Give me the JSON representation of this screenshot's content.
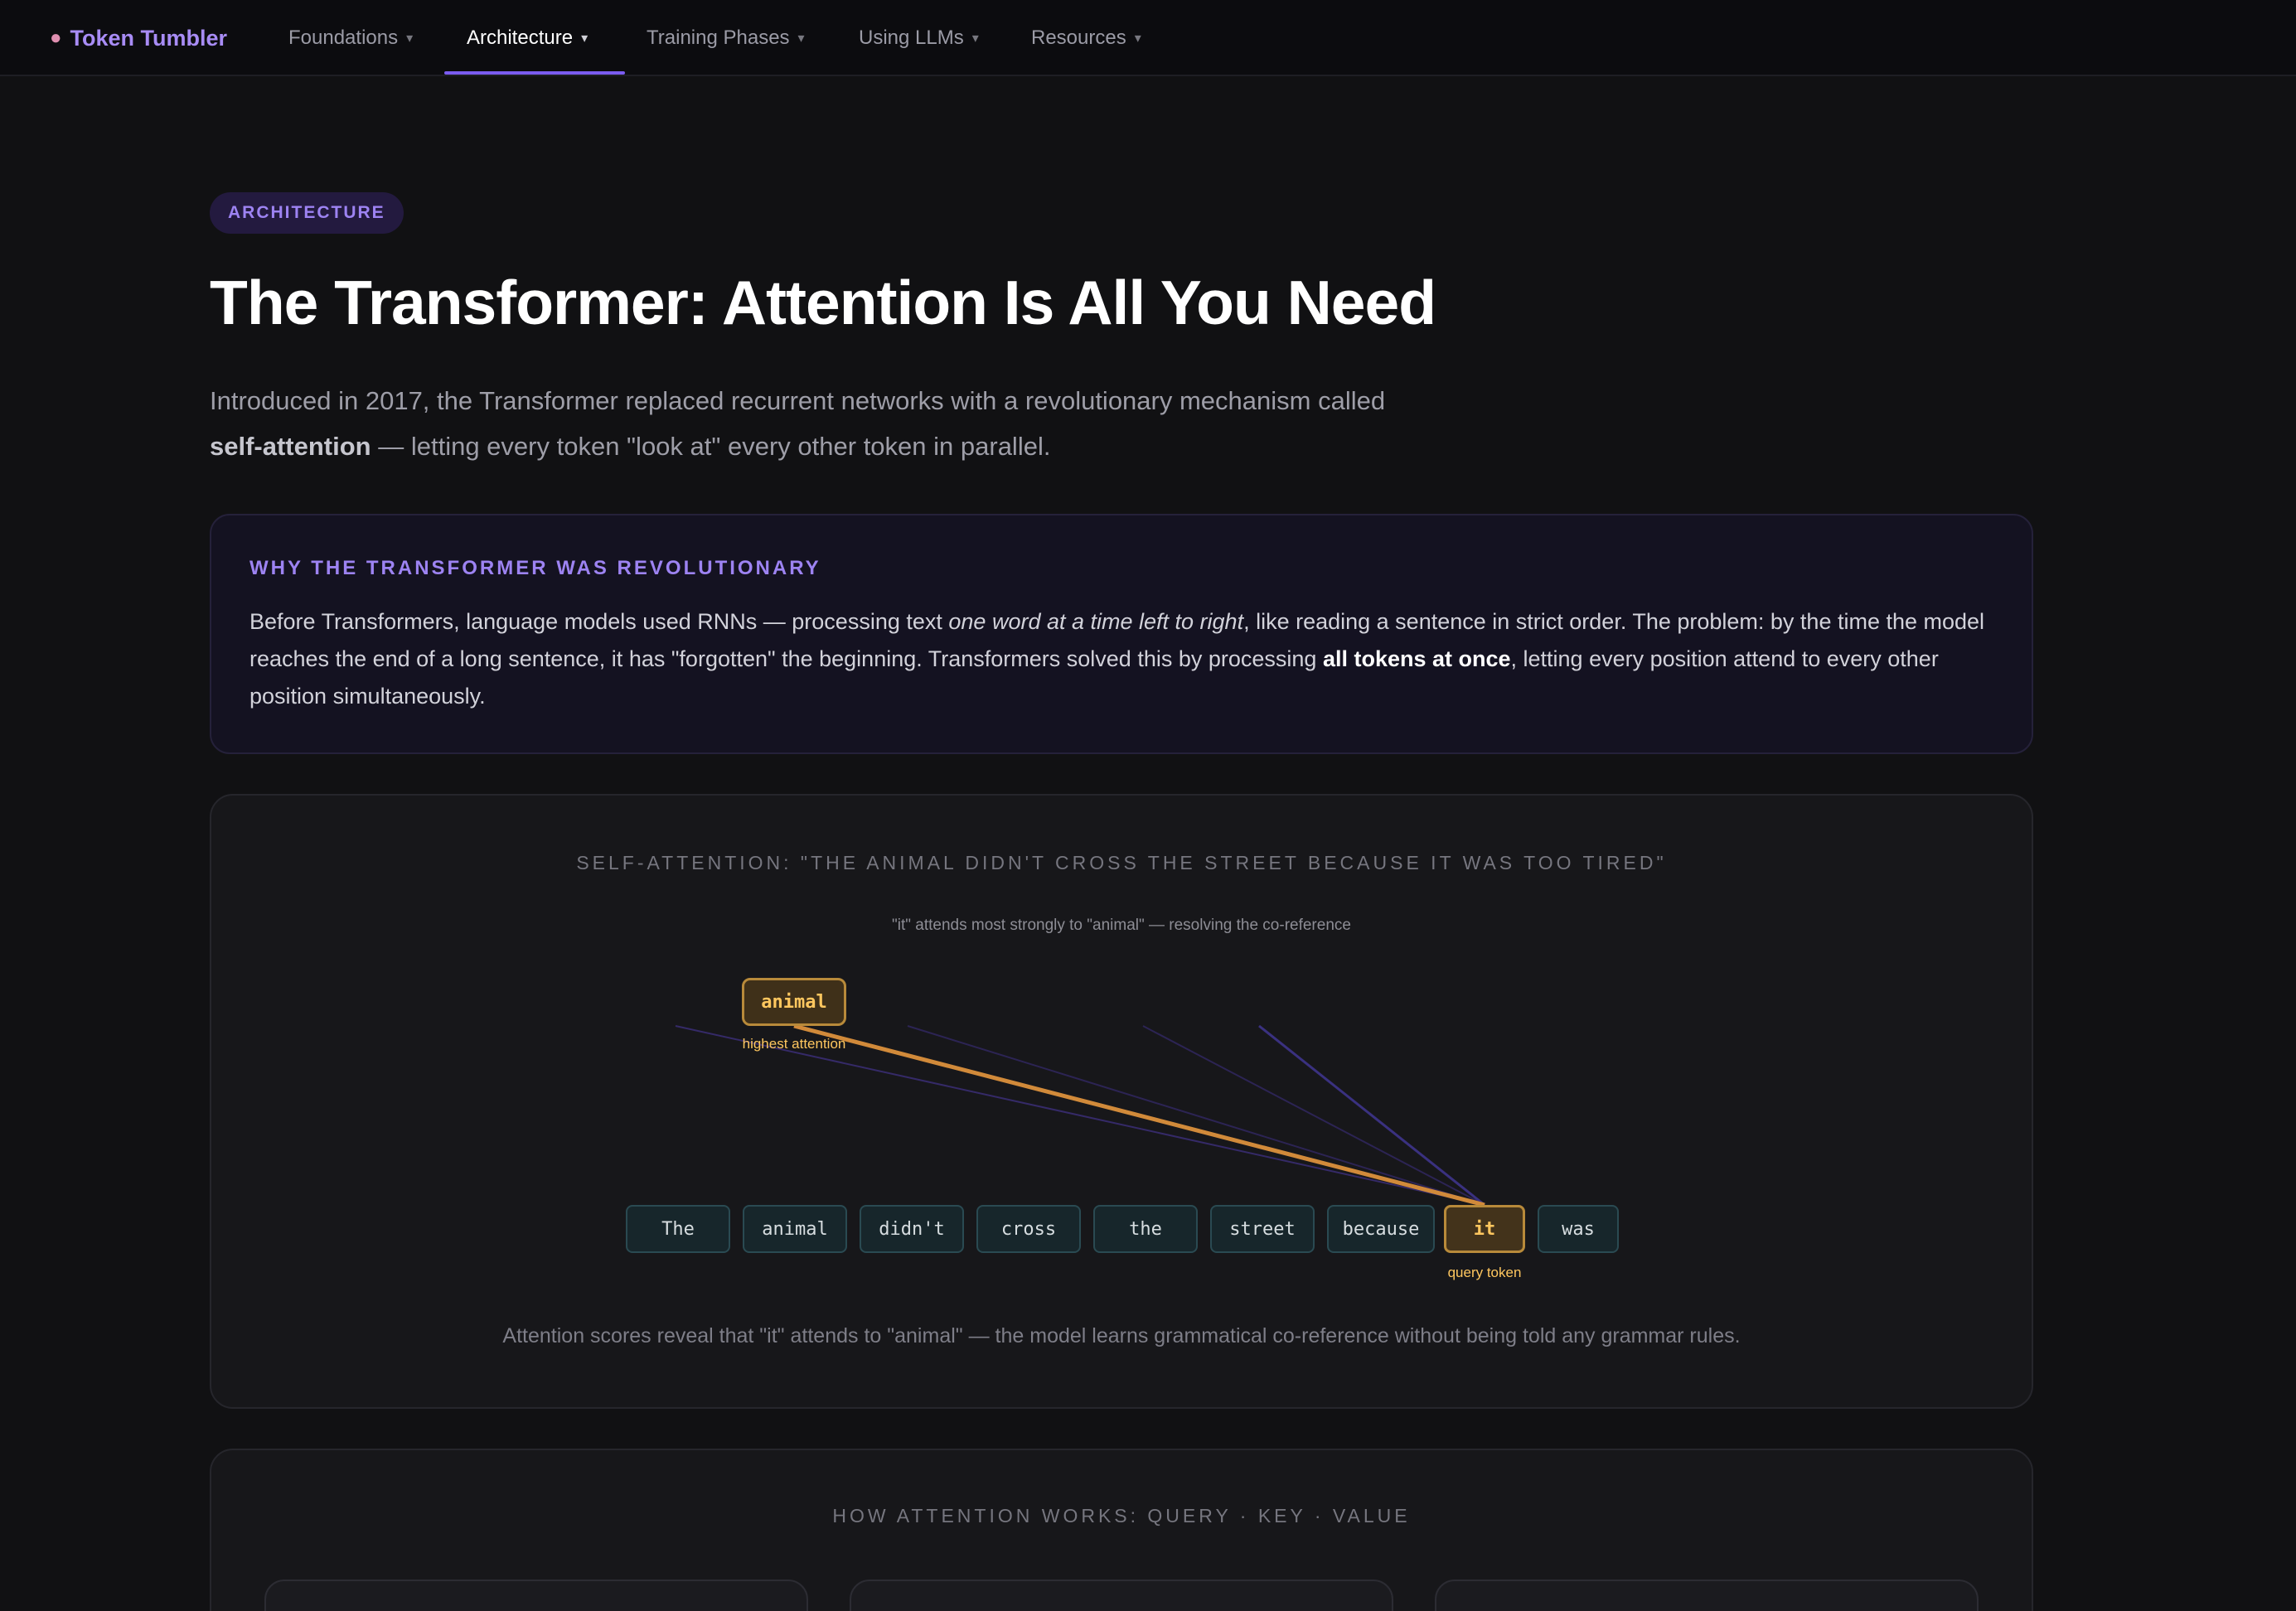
{
  "nav": {
    "brand": "Token Tumbler",
    "brand_icon": "brain-icon",
    "items": [
      {
        "label": "Foundations",
        "active": false
      },
      {
        "label": "Architecture",
        "active": true
      },
      {
        "label": "Training Phases",
        "active": false
      },
      {
        "label": "Using LLMs",
        "active": false
      },
      {
        "label": "Resources",
        "active": false
      }
    ],
    "caret": "▾"
  },
  "hero": {
    "badge": "ARCHITECTURE",
    "title": "The Transformer: Attention Is All You Need",
    "intro_before": "Introduced in 2017, the Transformer replaced recurrent networks with a revolutionary mechanism called ",
    "intro_bold": "self-attention",
    "intro_after": " — letting every token \"look at\" every other token in parallel."
  },
  "callout": {
    "title": "WHY THE TRANSFORMER WAS REVOLUTIONARY",
    "body_1": "Before Transformers, language models used RNNs — processing text ",
    "body_italic": "one word at a time left to right",
    "body_2": ", like reading a sentence in strict order. The problem: by the time the model reaches the end of a long sentence, it has \"forgotten\" the beginning. Transformers solved this by processing ",
    "body_bold": "all tokens at once",
    "body_3": ", letting every position attend to every other position simultaneously."
  },
  "attention": {
    "title": "SELF-ATTENTION: \"THE ANIMAL DIDN'T CROSS THE STREET BECAUSE IT WAS TOO TIRED\"",
    "subtitle": "\"it\" attends most strongly to \"animal\" — resolving the co-reference",
    "tokens": [
      "The",
      "animal",
      "didn't",
      "cross",
      "the",
      "street",
      "because",
      "it",
      "was"
    ],
    "query_token": "it",
    "query_label": "query token",
    "highlight_token": "animal",
    "highlight_label": "highest attention",
    "footer": "Attention scores reveal that \"it\" attends to \"animal\" — the model learns grammatical co-reference without being told any grammar rules.",
    "colors": {
      "strong": "#d18a3a",
      "weak": "#3b3070"
    }
  },
  "qkv": {
    "title": "HOW ATTENTION WORKS: QUERY · KEY · VALUE"
  }
}
